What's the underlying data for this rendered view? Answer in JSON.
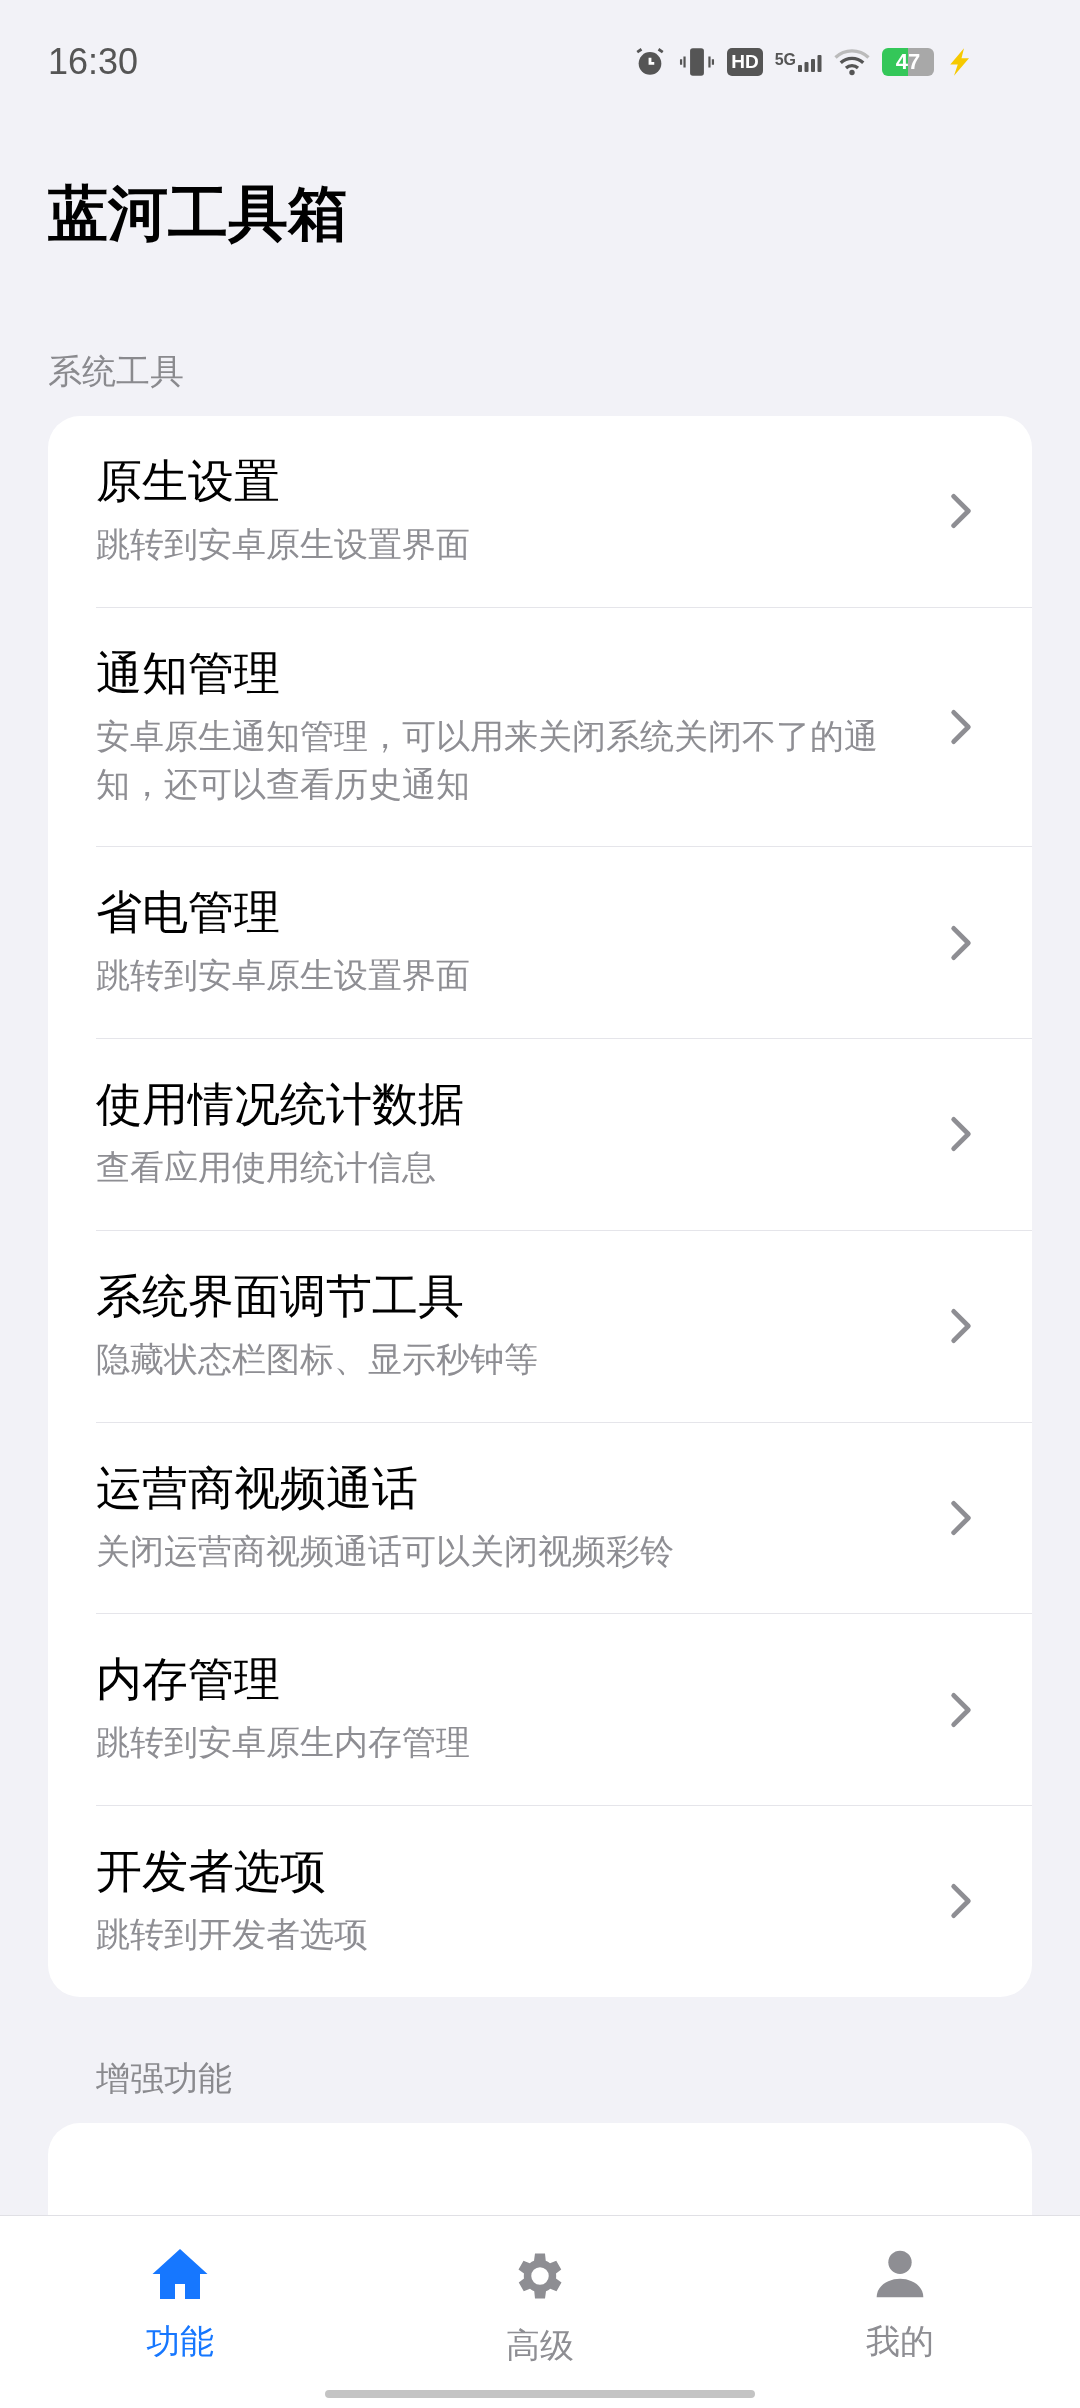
{
  "status_bar": {
    "time": "16:30",
    "indicators": [
      {
        "kind": "alarm"
      },
      {
        "kind": "vibrate"
      },
      {
        "kind": "hd",
        "text": "HD"
      },
      {
        "kind": "signal",
        "text": "5G"
      },
      {
        "kind": "wifi"
      },
      {
        "kind": "battery",
        "text": "47"
      },
      {
        "kind": "charging"
      }
    ]
  },
  "title": "蓝河工具箱",
  "sections": [
    {
      "label": "系统工具",
      "items": [
        {
          "title": "原生设置",
          "subtitle": "跳转到安卓原生设置界面"
        },
        {
          "title": "通知管理",
          "subtitle": "安卓原生通知管理，可以用来关闭系统关闭不了的通知，还可以查看历史通知"
        },
        {
          "title": "省电管理",
          "subtitle": "跳转到安卓原生设置界面"
        },
        {
          "title": "使用情况统计数据",
          "subtitle": "查看应用使用统计信息"
        },
        {
          "title": "系统界面调节工具",
          "subtitle": "隐藏状态栏图标、显示秒钟等"
        },
        {
          "title": "运营商视频通话",
          "subtitle": "关闭运营商视频通话可以关闭视频彩铃"
        },
        {
          "title": "内存管理",
          "subtitle": "跳转到安卓原生内存管理"
        },
        {
          "title": "开发者选项",
          "subtitle": "跳转到开发者选项"
        }
      ]
    },
    {
      "label": "增强功能"
    }
  ],
  "nav": [
    {
      "kind": "home",
      "label": "功能",
      "selected": true
    },
    {
      "kind": "gear",
      "label": "高级",
      "selected": false
    },
    {
      "kind": "person",
      "label": "我的",
      "selected": false
    }
  ]
}
